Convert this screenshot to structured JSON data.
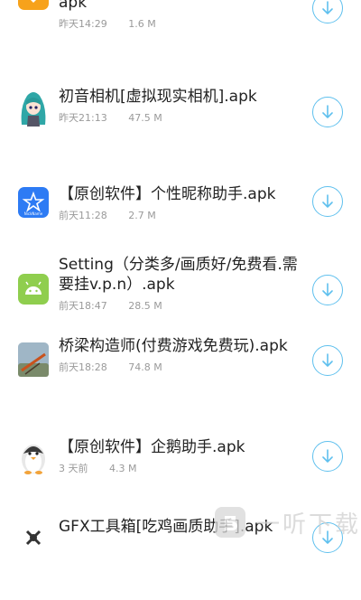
{
  "accent_color": "#5fc0ee",
  "apps": [
    {
      "icon": "heart-app-icon",
      "title": "装扮盒子[各种免费装扮等你设置].apk",
      "date": "昨天14:29",
      "size": "1.6 M"
    },
    {
      "icon": "anime-character-app-icon",
      "title": "初音相机[虚拟现实相机].apk",
      "date": "昨天21:13",
      "size": "47.5 M"
    },
    {
      "icon": "star-app-icon",
      "title": "【原创软件】个性昵称助手.apk",
      "date": "前天11:28",
      "size": "2.7 M"
    },
    {
      "icon": "android-app-icon",
      "title": "Setting（分类多/画质好/免费看.需要挂v.p.n）.apk",
      "date": "前天18:47",
      "size": "28.5 M"
    },
    {
      "icon": "bridge-game-app-icon",
      "title": "桥梁构造师(付费游戏免费玩).apk",
      "date": "前天18:28",
      "size": "74.8 M"
    },
    {
      "icon": "penguin-app-icon",
      "title": "【原创软件】企鹅助手.apk",
      "date": "3 天前",
      "size": "4.3 M"
    },
    {
      "icon": "gfx-tool-app-icon",
      "title": "GFX工具箱[吃鸡画质助手].apk",
      "date": "",
      "size": ""
    }
  ],
  "watermark": {
    "text": "一听下载"
  }
}
